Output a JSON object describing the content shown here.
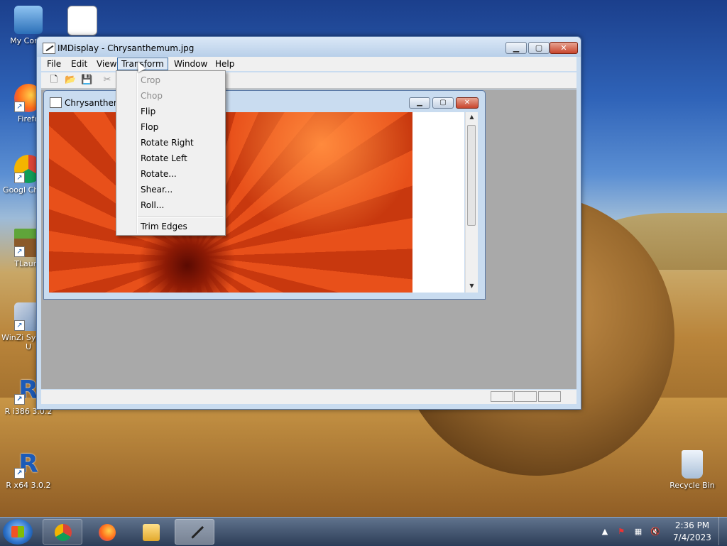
{
  "desktop": {
    "icons": [
      {
        "label": "My Comp",
        "icon": "computer-icon"
      },
      {
        "label": "",
        "icon": "network-hub-icon"
      },
      {
        "label": "Firefo",
        "icon": "firefox-icon"
      },
      {
        "label": "Googl Chrom",
        "icon": "chrome-icon"
      },
      {
        "label": "TLaunc",
        "icon": "minecraft-block-icon"
      },
      {
        "label": "WinZi System U",
        "icon": "winzip-icon"
      },
      {
        "label": "R i386 3.0.2",
        "icon": "r-logo-icon"
      },
      {
        "label": "R x64 3.0.2",
        "icon": "r-logo-icon"
      },
      {
        "label": "Recycle Bin",
        "icon": "recycle-bin-icon"
      }
    ]
  },
  "window": {
    "title": "IMDisplay - Chrysanthemum.jpg",
    "caption": {
      "minimize": "▁",
      "maximize": "▢",
      "close": "✕"
    },
    "menu": [
      "File",
      "Edit",
      "View",
      "Transform",
      "Window",
      "Help"
    ],
    "toolbar": {
      "new": "🗋",
      "open": "📂",
      "save": "💾",
      "cut": "✂"
    }
  },
  "child_window": {
    "title": "Chrysanthemu",
    "caption": {
      "minimize": "▁",
      "maximize": "▢",
      "close": "✕"
    }
  },
  "transform_menu": {
    "items": [
      {
        "label": "Crop",
        "enabled": false
      },
      {
        "label": "Chop",
        "enabled": false
      },
      {
        "label": "Flip",
        "enabled": true
      },
      {
        "label": "Flop",
        "enabled": true
      },
      {
        "label": "Rotate Right",
        "enabled": true
      },
      {
        "label": "Rotate Left",
        "enabled": true
      },
      {
        "label": "Rotate...",
        "enabled": true
      },
      {
        "label": "Shear...",
        "enabled": true
      },
      {
        "label": "Roll...",
        "enabled": true
      }
    ],
    "after_separator": {
      "label": "Trim Edges",
      "enabled": true
    }
  },
  "taskbar": {
    "apps": [
      "chrome-icon",
      "firefox-icon",
      "file-explorer-icon",
      "imdisplay-wand-icon"
    ],
    "tray": [
      "show-hidden-icons-arrow",
      "action-center-flag-icon",
      "network-icon",
      "volume-muted-icon"
    ],
    "clock": {
      "time": "2:36 PM",
      "date": "7/4/2023"
    }
  }
}
